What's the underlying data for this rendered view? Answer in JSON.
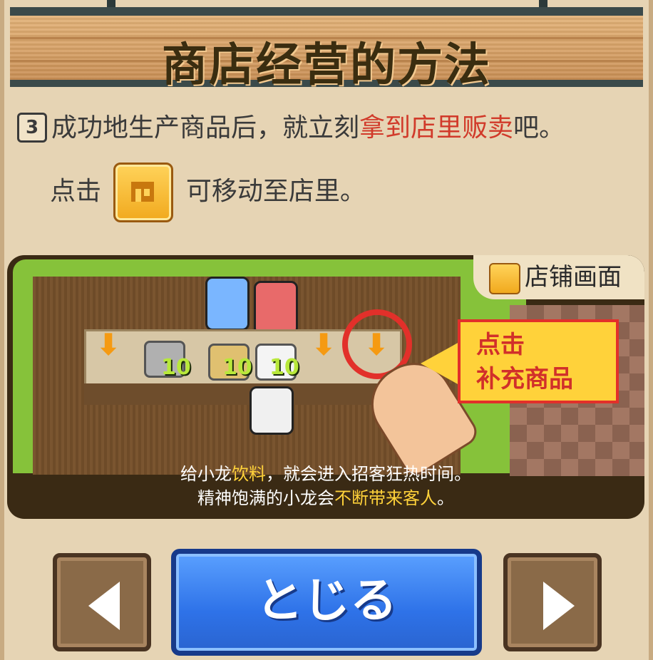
{
  "title": "商店经营的方法",
  "instruction": {
    "step_number": "3",
    "line1_a": "成功地生产商品后，就立刻",
    "line1_highlight": "拿到店里贩卖",
    "line1_b": "吧。",
    "line2_a": "点击",
    "line2_b": "可移动至店里。"
  },
  "tutorial": {
    "screen_label": "店铺画面",
    "item_counts": [
      "10",
      "10",
      "10"
    ],
    "callout_line1": "点击",
    "callout_line2": "补充商品",
    "caption_line1_a": "给小龙",
    "caption_line1_highlight": "饮料",
    "caption_line1_b": "，就会进入招客狂热时间。",
    "caption_line2_a": "精神饱满的小龙会",
    "caption_line2_highlight": "不断带来客人",
    "caption_line2_b": "。"
  },
  "buttons": {
    "close_label": "とじる"
  },
  "icons": {
    "prev": "left-arrow-icon",
    "next": "right-arrow-icon",
    "shop": "shop-icon",
    "restock": "down-arrow-icon"
  },
  "colors": {
    "highlight_red": "#d13a2a",
    "highlight_yellow": "#ffd23a",
    "close_button_blue": "#2e72e8"
  }
}
